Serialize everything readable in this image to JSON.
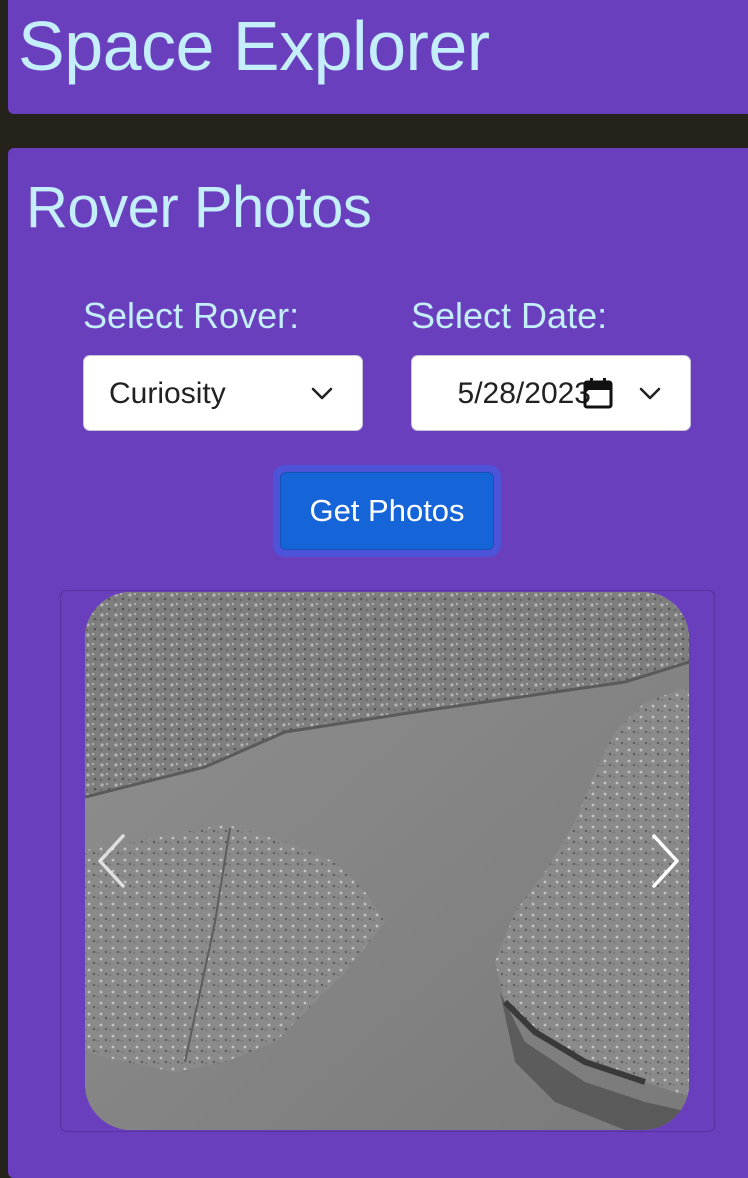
{
  "header": {
    "title": "Space Explorer"
  },
  "rover_section": {
    "title": "Rover Photos",
    "rover_label": "Select Rover:",
    "rover_value": "Curiosity",
    "date_label": "Select Date:",
    "date_value": "5/28/2023",
    "submit_label": "Get Photos"
  },
  "carousel": {
    "prev_icon": "chevron-left",
    "next_icon": "chevron-right"
  },
  "colors": {
    "panel": "#6a3fbe",
    "heading": "#c3eefa",
    "button": "#1565d8",
    "page_background": "#25211b"
  }
}
